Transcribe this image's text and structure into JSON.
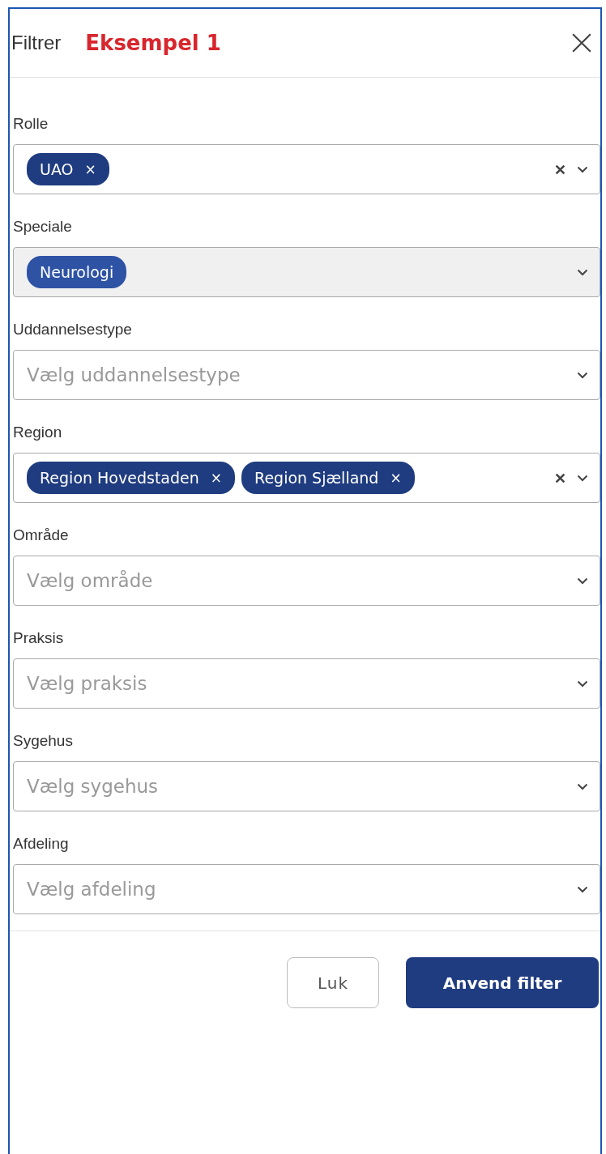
{
  "header": {
    "title": "Filtrer",
    "tag": "Eksempel 1"
  },
  "filters": [
    {
      "label": "Rolle",
      "disabled": false,
      "clearable": true,
      "chips": [
        {
          "text": "UAO",
          "remove": "×"
        }
      ]
    },
    {
      "label": "Speciale",
      "disabled": true,
      "clearable": false,
      "chips": [
        {
          "text": "Neurologi"
        }
      ]
    },
    {
      "label": "Uddannelsestype",
      "disabled": false,
      "clearable": false,
      "placeholder": "Vælg uddannelsestype"
    },
    {
      "label": "Region",
      "disabled": false,
      "clearable": true,
      "chips": [
        {
          "text": "Region Hovedstaden",
          "remove": "×"
        },
        {
          "text": "Region Sjælland",
          "remove": "×"
        }
      ]
    },
    {
      "label": "Område",
      "disabled": false,
      "clearable": false,
      "placeholder": "Vælg område"
    },
    {
      "label": "Praksis",
      "disabled": false,
      "clearable": false,
      "placeholder": "Vælg praksis"
    },
    {
      "label": "Sygehus",
      "disabled": false,
      "clearable": false,
      "placeholder": "Vælg sygehus"
    },
    {
      "label": "Afdeling",
      "disabled": false,
      "clearable": false,
      "placeholder": "Vælg afdeling"
    }
  ],
  "buttons": [
    {
      "label": "Luk",
      "kind": "secondary"
    },
    {
      "label": "Anvend filter",
      "kind": "primary"
    }
  ]
}
